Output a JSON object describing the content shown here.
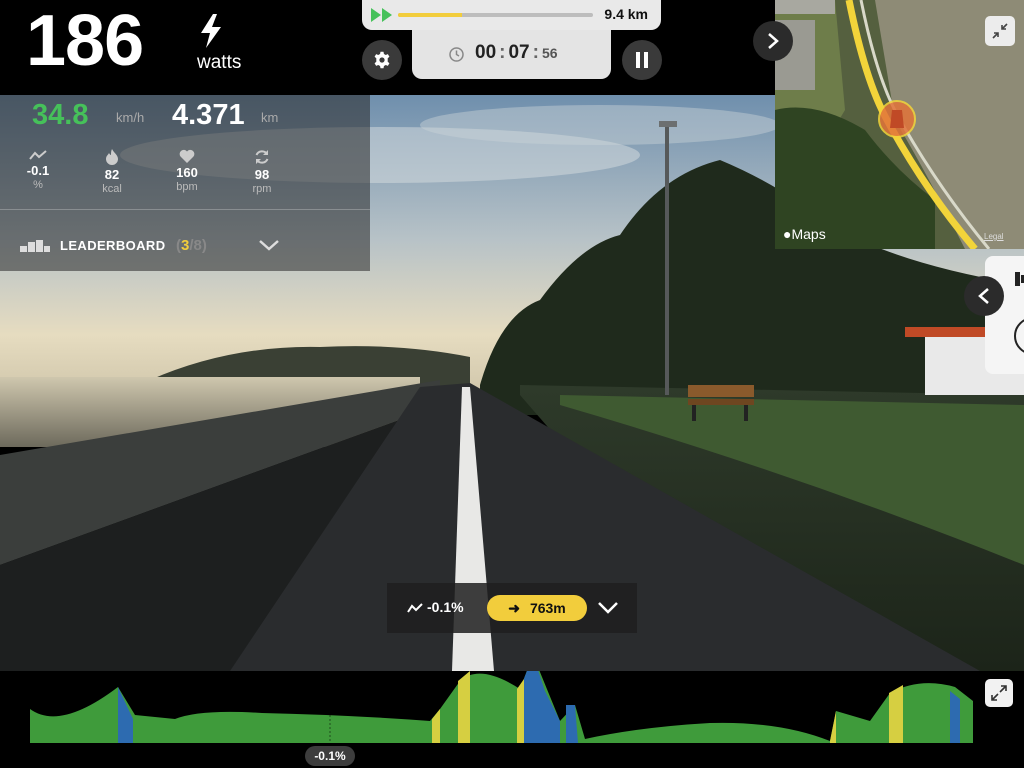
{
  "power": {
    "value": "186",
    "unit": "watts",
    "icon": "bolt-icon"
  },
  "progress": {
    "fraction": 0.33,
    "distance_total": "9.4 km",
    "fill_color": "#f2cd3c",
    "icon": "fast-forward-icon"
  },
  "timer": {
    "hours": "00",
    "minutes": "07",
    "seconds": "56",
    "icon": "clock-icon"
  },
  "controls": {
    "settings_icon": "gear-icon",
    "pause_icon": "pause-icon"
  },
  "stats": {
    "speed": {
      "value": "34.8",
      "unit": "km/h",
      "color": "#46c15a"
    },
    "distance": {
      "value": "4.371",
      "unit": "km"
    },
    "items": [
      {
        "icon": "grade-icon",
        "value": "-0.1",
        "unit": "%"
      },
      {
        "icon": "flame-icon",
        "value": "82",
        "unit": "kcal"
      },
      {
        "icon": "heart-icon",
        "value": "160",
        "unit": "bpm"
      },
      {
        "icon": "cadence-icon",
        "value": "98",
        "unit": "rpm"
      }
    ]
  },
  "leaderboard": {
    "label": "LEADERBOARD",
    "open": "(",
    "position": "3",
    "separator": "/",
    "total": "8",
    "close": ")"
  },
  "map": {
    "brand": "Maps",
    "legal": "Legal"
  },
  "segment": {
    "grade": "-0.1%",
    "distance": "763m"
  },
  "elevation": {
    "current_grade": "-0.1%"
  },
  "colors": {
    "accent": "#f2cd3c",
    "green": "#46c15a",
    "elev_green": "#3f9b3b",
    "elev_blue": "#2d6bb0",
    "elev_yellow": "#d6cf41"
  }
}
